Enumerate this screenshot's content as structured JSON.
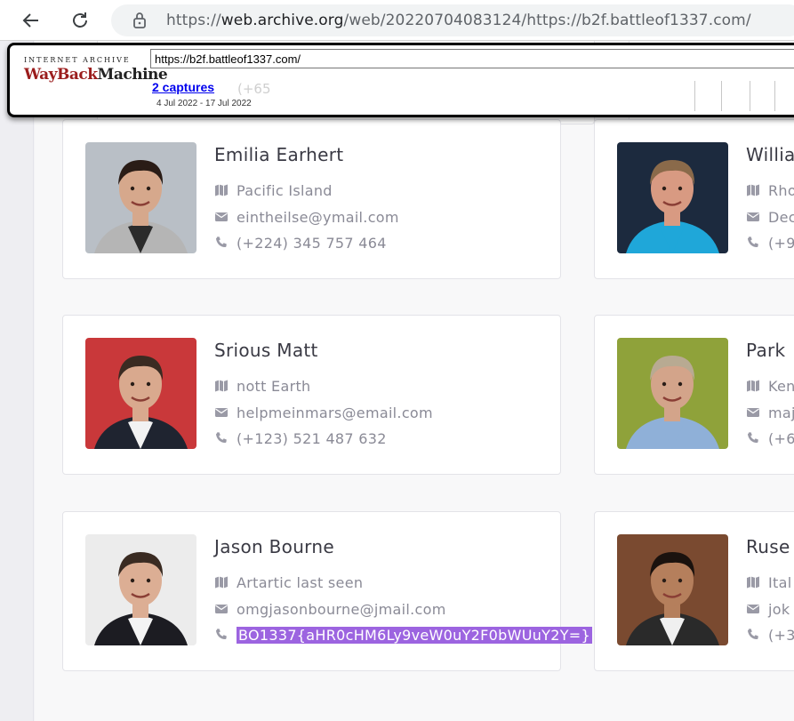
{
  "browser": {
    "url_prefix": "https://",
    "url_domain": "web.archive.org",
    "url_path": "/web/20220704083124/https://b2f.battleof1337.com/"
  },
  "wayback": {
    "logo_top": "INTERNET ARCHIVE",
    "logo_main_a": "WayBack",
    "logo_main_b": "Machine",
    "url_value": "https://b2f.battleof1337.com/",
    "captures": "2 captures",
    "dates": "4 Jul 2022 - 17 Jul 2022",
    "ghost_text": "(+65"
  },
  "cards": [
    {
      "name": "Emilia Earhert",
      "location": "Pacific Island",
      "email": "eintheilse@ymail.com",
      "phone": "(+224) 345 757 464",
      "photo_colors": {
        "bg": "#b9bfc6",
        "hair": "#2a1c16",
        "skin": "#d6a88c",
        "shirt": "#2b2b2b",
        "jacket": "#b5b5b5"
      }
    },
    {
      "name": "Willia",
      "location": "Rho",
      "email": "Dec",
      "phone": "(+9",
      "photo_colors": {
        "bg": "#1c2a3e",
        "hair": "#8a6a4a",
        "skin": "#d89a82",
        "shirt": "#1fa7d9",
        "jacket": "#1fa7d9"
      }
    },
    {
      "name": "Srious Matt",
      "location": "nott Earth",
      "email": "helpmeinmars@email.com",
      "phone": "(+123) 521 487 632",
      "photo_colors": {
        "bg": "#c9383a",
        "hair": "#3a2b22",
        "skin": "#d9a98e",
        "shirt": "#f2f2f2",
        "jacket": "#1f2430"
      }
    },
    {
      "name": "Park",
      "location": "Ken",
      "email": "maj",
      "phone": "(+6",
      "photo_colors": {
        "bg": "#8fa23a",
        "hair": "#b8aa92",
        "skin": "#d3a48a",
        "shirt": "#8fb0d8",
        "jacket": "#8fb0d8"
      }
    },
    {
      "name": "Jason Bourne",
      "location": "Artartic last seen",
      "email": "omgjasonbourne@jmail.com",
      "phone": "BO1337{aHR0cHM6Ly9veW0uY2F0bWUuY2Y=}",
      "photo_colors": {
        "bg": "#ececec",
        "hair": "#3a2b22",
        "skin": "#dcae94",
        "shirt": "#f4f4f4",
        "jacket": "#1c1c22"
      }
    },
    {
      "name": "Ruse",
      "location": "Ital",
      "email": "jok",
      "phone": "(+3",
      "photo_colors": {
        "bg": "#7a4a30",
        "hair": "#1a120e",
        "skin": "#b57f5c",
        "shirt": "#f0f0f0",
        "jacket": "#2a2a2a"
      }
    }
  ]
}
